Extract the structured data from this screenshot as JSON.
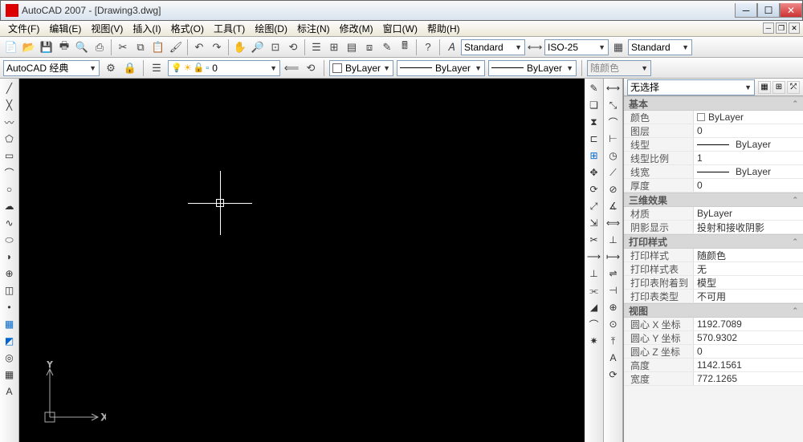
{
  "title": "AutoCAD 2007 - [Drawing3.dwg]",
  "menus": [
    "文件(F)",
    "编辑(E)",
    "视图(V)",
    "插入(I)",
    "格式(O)",
    "工具(T)",
    "绘图(D)",
    "标注(N)",
    "修改(M)",
    "窗口(W)",
    "帮助(H)"
  ],
  "tb1": {
    "style1": "Standard",
    "style2": "ISO-25",
    "style3": "Standard"
  },
  "ws": {
    "workspace": "AutoCAD 经典",
    "layer": "0",
    "bylayer": "ByLayer",
    "linetype": "ByLayer",
    "lineweight": "ByLayer",
    "plotcolor": "随颜色"
  },
  "props": {
    "sel": "无选择",
    "groups": {
      "basic": {
        "title": "基本",
        "color_l": "颜色",
        "color_v": "ByLayer",
        "layer_l": "图层",
        "layer_v": "0",
        "ltype_l": "线型",
        "ltype_v": "ByLayer",
        "ltscale_l": "线型比例",
        "ltscale_v": "1",
        "lw_l": "线宽",
        "lw_v": "ByLayer",
        "thick_l": "厚度",
        "thick_v": "0"
      },
      "three_d": {
        "title": "三维效果",
        "mat_l": "材质",
        "mat_v": "ByLayer",
        "shadow_l": "阴影显示",
        "shadow_v": "投射和接收阴影"
      },
      "plot": {
        "title": "打印样式",
        "ps_l": "打印样式",
        "ps_v": "随颜色",
        "pst_l": "打印样式表",
        "pst_v": "无",
        "psa_l": "打印表附着到",
        "psa_v": "模型",
        "pstype_l": "打印表类型",
        "pstype_v": "不可用"
      },
      "view": {
        "title": "视图",
        "cx_l": "圆心 X 坐标",
        "cx_v": "1192.7089",
        "cy_l": "圆心 Y 坐标",
        "cy_v": "570.9302",
        "cz_l": "圆心 Z 坐标",
        "cz_v": "0",
        "h_l": "高度",
        "h_v": "1142.1561",
        "w_l": "宽度",
        "w_v": "772.1265"
      }
    }
  }
}
